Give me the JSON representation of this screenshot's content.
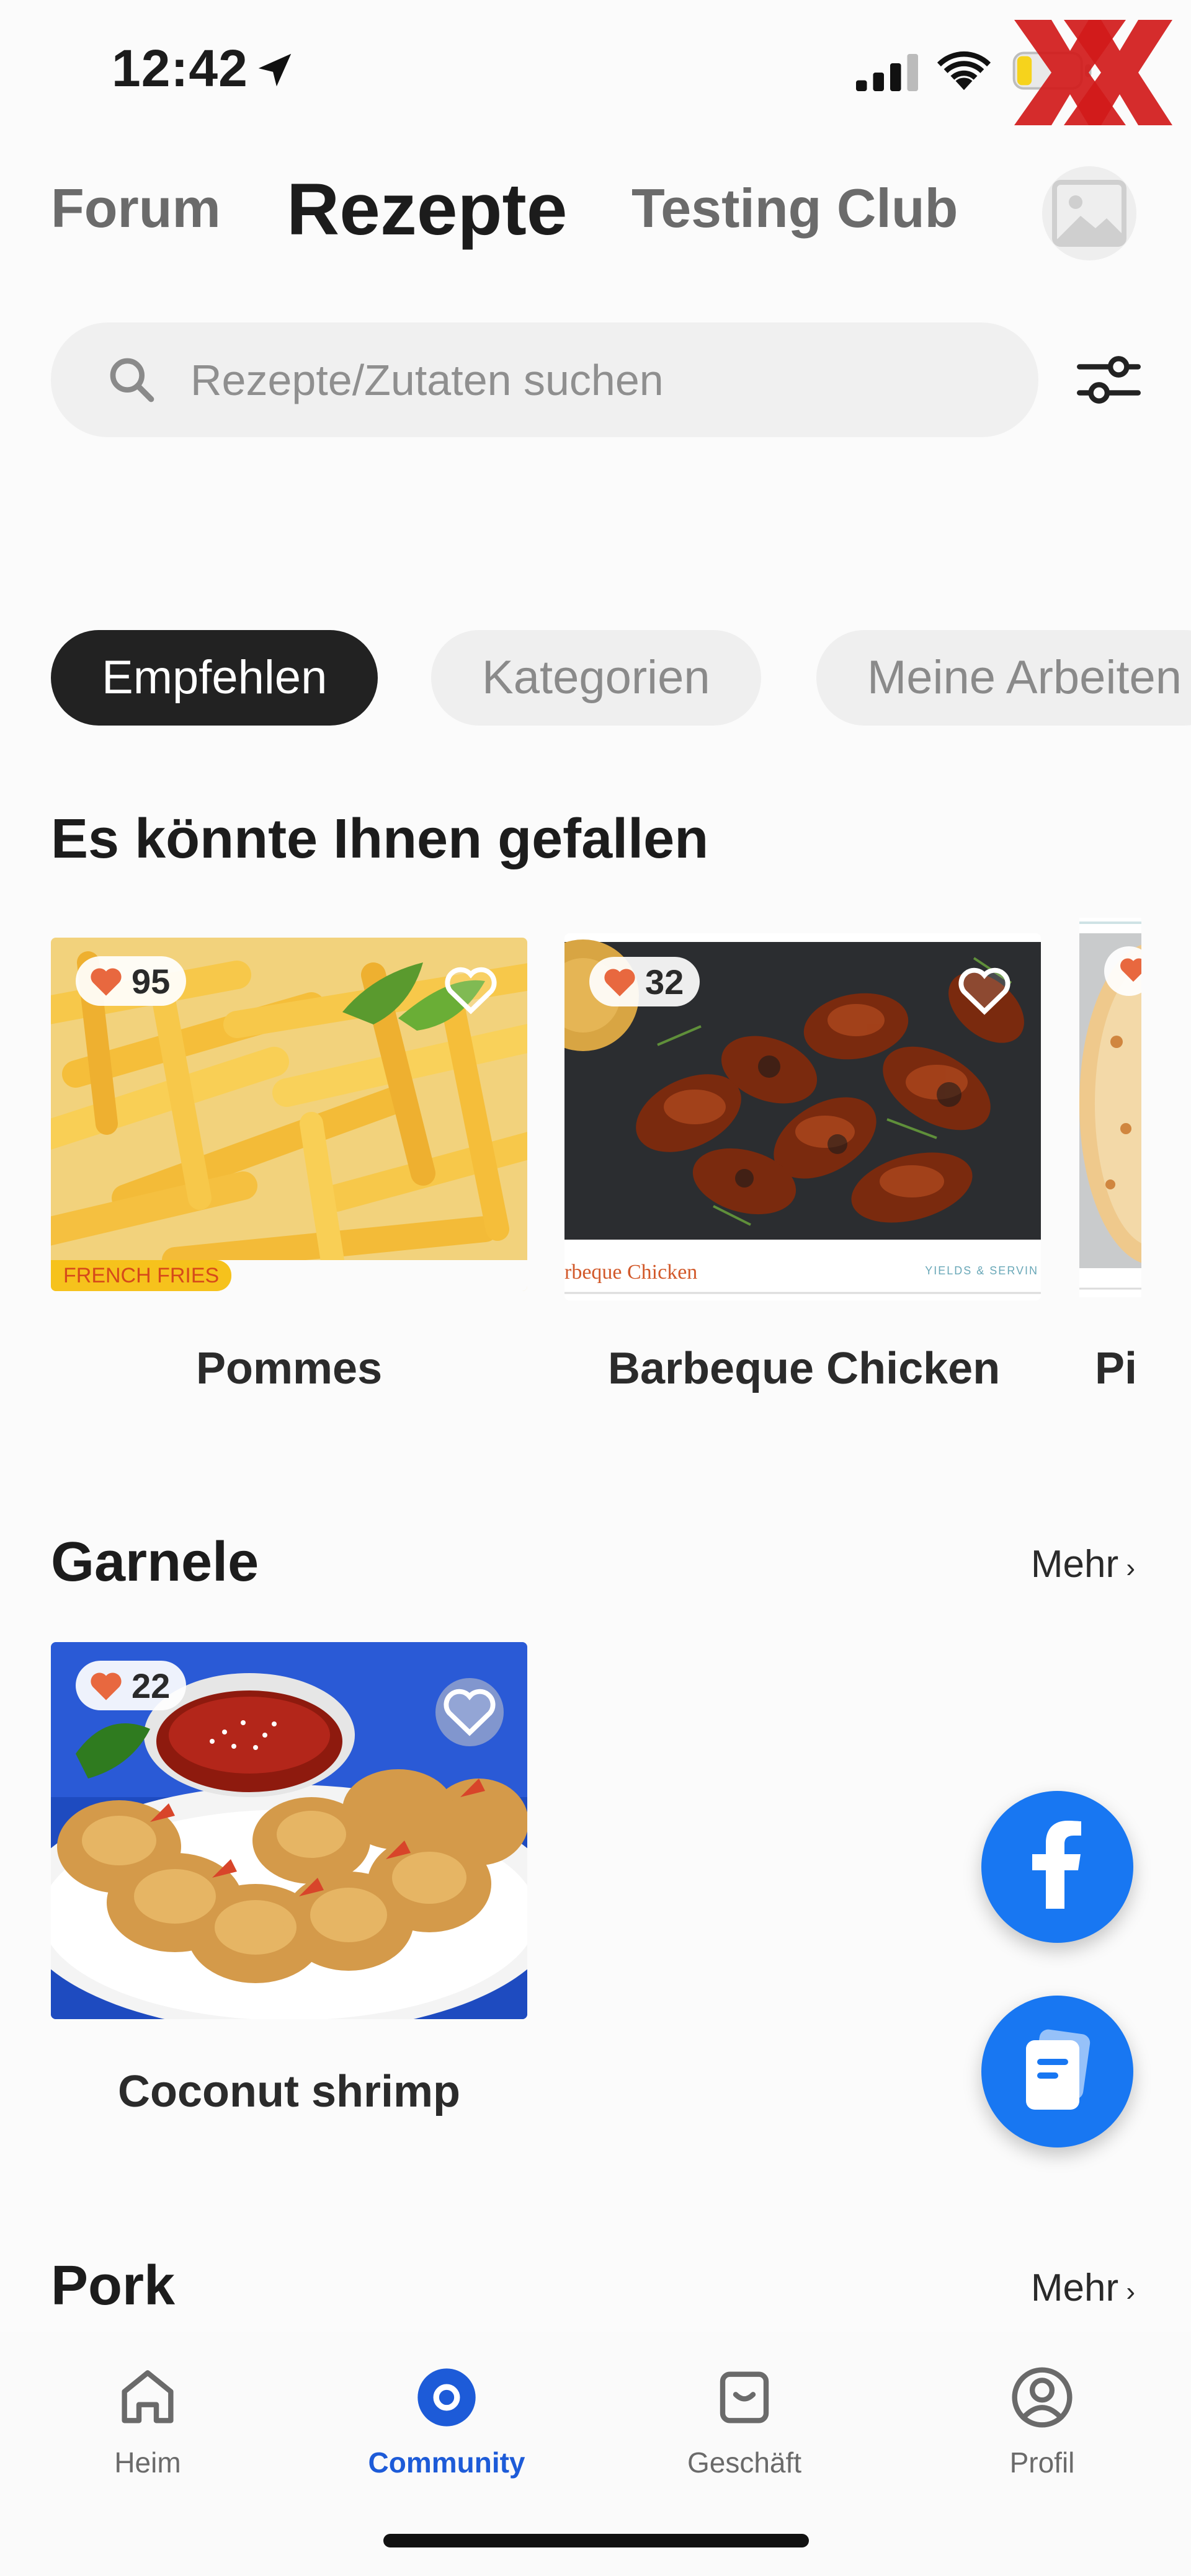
{
  "status_bar": {
    "time": "12:42",
    "battery_label": "18"
  },
  "top_tabs": [
    {
      "label": "Forum",
      "active": false
    },
    {
      "label": "Rezepte",
      "active": true
    },
    {
      "label": "Testing Club",
      "active": false
    }
  ],
  "search": {
    "placeholder": "Rezepte/Zutaten suchen"
  },
  "chips": [
    {
      "label": "Empfehlen",
      "active": true
    },
    {
      "label": "Kategorien",
      "active": false
    },
    {
      "label": "Meine Arbeiten",
      "active": false
    }
  ],
  "recommended": {
    "title": "Es könnte Ihnen gefallen",
    "cards": [
      {
        "title": "Pommes",
        "likes": "95",
        "image_caption": "FRENCH FRIES"
      },
      {
        "title": "Barbeque Chicken",
        "likes": "32",
        "image_caption": "rbeque Chicken",
        "image_caption_right": "YIELDS & SERVIN"
      },
      {
        "title": "Pi",
        "likes": ""
      }
    ]
  },
  "sections": [
    {
      "title": "Garnele",
      "more_label": "Mehr",
      "cards": [
        {
          "title": "Coconut shrimp",
          "likes": "22"
        }
      ]
    },
    {
      "title": "Pork",
      "more_label": "Mehr"
    }
  ],
  "bottom_nav": [
    {
      "label": "Heim",
      "icon": "home-icon",
      "active": false
    },
    {
      "label": "Community",
      "icon": "community-icon",
      "active": true
    },
    {
      "label": "Geschäft",
      "icon": "shop-bag-icon",
      "active": false
    },
    {
      "label": "Profil",
      "icon": "profile-icon",
      "active": false
    }
  ],
  "colors": {
    "accent_blue": "#1d5bd8",
    "facebook_blue": "#1877f2",
    "heart": "#e8683f",
    "chip_active": "#222222"
  }
}
